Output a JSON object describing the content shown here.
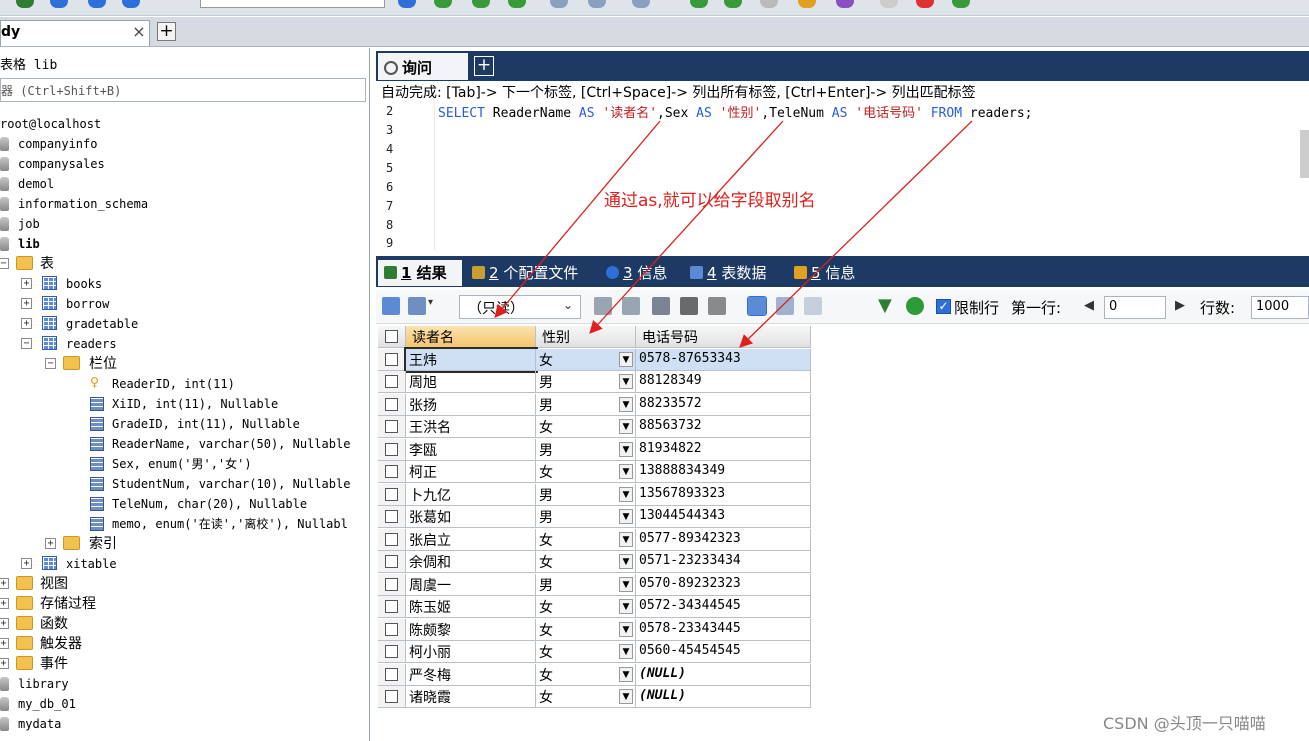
{
  "window": {
    "connection_tab": "dy",
    "close_glyph": "×",
    "add_glyph": "+"
  },
  "object_browser": {
    "title": "表格 lib",
    "filter_placeholder": "器 (Ctrl+Shift+B)",
    "connection": "root@localhost",
    "databases": [
      "companyinfo",
      "companysales",
      "demol",
      "information_schema",
      "job",
      "lib"
    ],
    "lib_children": {
      "tables_label": "表",
      "tables": [
        "books",
        "borrow",
        "gradetable",
        "readers"
      ],
      "columns_label": "栏位",
      "columns": [
        "ReaderID, int(11)",
        "XiID, int(11), Nullable",
        "GradeID, int(11), Nullable",
        "ReaderName, varchar(50), Nullable",
        "Sex, enum('男','女')",
        "StudentNum, varchar(10), Nullable",
        "TeleNum, char(20), Nullable",
        "memo, enum('在读','离校'), Nullabl"
      ],
      "index_label": "索引",
      "extra_table": "xitable",
      "other_folders": [
        "视图",
        "存储过程",
        "函数",
        "触发器",
        "事件"
      ]
    },
    "more_databases": [
      "library",
      "my_db_01",
      "mydata"
    ]
  },
  "query": {
    "tab_label": "询问",
    "autocomplete_hint": "自动完成: [Tab]-> 下一个标签, [Ctrl+Space]-> 列出所有标签, [Ctrl+Enter]-> 列出匹配标签",
    "line_numbers": [
      "2",
      "3",
      "4",
      "5",
      "6",
      "7",
      "8",
      "9"
    ],
    "sql": {
      "k1": "SELECT",
      "t1": " ReaderName ",
      "k2": "AS",
      "s1": " '读者名'",
      "t2": ",Sex ",
      "k3": "AS",
      "s2": " '性别'",
      "t3": ",TeleNum ",
      "k4": "AS",
      "s3": " '电话号码'",
      "k5": " FROM",
      "t4": " readers;"
    },
    "annotation": "通过as,就可以给字段取别名"
  },
  "result_tabs": [
    {
      "num": "1",
      "label": " 结果",
      "color": "#2e7d32"
    },
    {
      "num": "2",
      "label": " 个配置文件",
      "color": "#c8a030"
    },
    {
      "num": "3",
      "label": " 信息",
      "color": "#2f6fd8"
    },
    {
      "num": "4",
      "label": " 表数据",
      "color": "#5b8bd6"
    },
    {
      "num": "5",
      "label": " 信息",
      "color": "#e0a020"
    }
  ],
  "grid_toolbar": {
    "mode": "（只读）",
    "limit_label": "限制行",
    "first_row_label": "第一行:",
    "first_row_value": "0",
    "rows_label": "行数:",
    "rows_value": "1000"
  },
  "grid": {
    "headers": [
      "读者名",
      "性别",
      "电话号码"
    ],
    "rows": [
      [
        "王炜",
        "女",
        "0578-87653343"
      ],
      [
        "周旭",
        "男",
        "88128349"
      ],
      [
        "张扬",
        "男",
        "88233572"
      ],
      [
        "王洪名",
        "女",
        "88563732"
      ],
      [
        "李瓯",
        "男",
        "81934822"
      ],
      [
        "柯正",
        "女",
        "13888834349"
      ],
      [
        "卜九亿",
        "男",
        "13567893323"
      ],
      [
        "张葛如",
        "男",
        "13044544343"
      ],
      [
        "张启立",
        "女",
        "0577-89342323"
      ],
      [
        "余倜和",
        "女",
        "0571-23233434"
      ],
      [
        "周虞一",
        "男",
        "0570-89232323"
      ],
      [
        "陈玉姬",
        "女",
        "0572-34344545"
      ],
      [
        "陈颇黎",
        "女",
        "0578-23343445"
      ],
      [
        "柯小丽",
        "女",
        "0560-45454545"
      ],
      [
        "严冬梅",
        "女",
        "(NULL)"
      ],
      [
        "诸晓霞",
        "女",
        "(NULL)"
      ]
    ]
  },
  "watermark": "CSDN @头顶一只喵喵"
}
